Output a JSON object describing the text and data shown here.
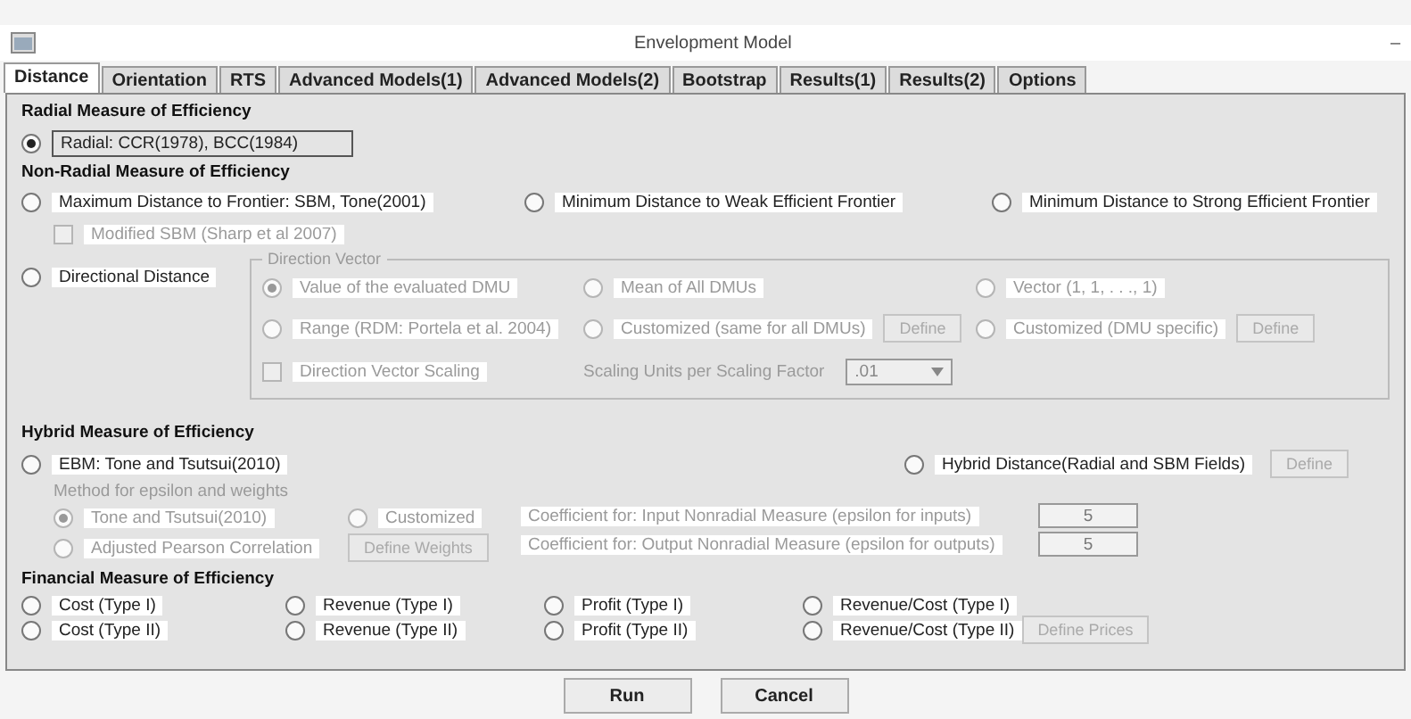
{
  "window": {
    "title": "Envelopment Model",
    "minimize": "–"
  },
  "tabs": [
    {
      "label": "Distance",
      "selected": true
    },
    {
      "label": "Orientation",
      "selected": false
    },
    {
      "label": "RTS",
      "selected": false
    },
    {
      "label": "Advanced Models(1)",
      "selected": false
    },
    {
      "label": "Advanced Models(2)",
      "selected": false
    },
    {
      "label": "Bootstrap",
      "selected": false
    },
    {
      "label": "Results(1)",
      "selected": false
    },
    {
      "label": "Results(2)",
      "selected": false
    },
    {
      "label": "Options",
      "selected": false
    }
  ],
  "radial": {
    "heading": "Radial Measure of Efficiency",
    "option": {
      "label": "Radial: CCR(1978), BCC(1984)",
      "selected": true
    }
  },
  "non_radial": {
    "heading": "Non-Radial Measure of Efficiency",
    "options": [
      {
        "label": "Maximum Distance to Frontier: SBM, Tone(2001)",
        "selected": false
      },
      {
        "label": "Minimum Distance to Weak Efficient Frontier",
        "selected": false
      },
      {
        "label": "Minimum Distance to Strong Efficient Frontier",
        "selected": false
      }
    ],
    "modified_sbm": {
      "label": "Modified SBM (Sharp et al 2007)",
      "checked": false,
      "disabled": true
    }
  },
  "directional": {
    "option": {
      "label": "Directional Distance",
      "selected": false
    },
    "group": {
      "title": "Direction Vector",
      "disabled": true,
      "options": [
        {
          "label": "Value of the evaluated DMU",
          "selected": true
        },
        {
          "label": "Mean of All DMUs",
          "selected": false
        },
        {
          "label": "Vector (1, 1, . . ., 1)",
          "selected": false
        },
        {
          "label": "Range (RDM: Portela et al. 2004)",
          "selected": false
        },
        {
          "label": "Customized (same for all DMUs)",
          "selected": false,
          "button": "Define"
        },
        {
          "label": "Customized (DMU specific)",
          "selected": false,
          "button": "Define"
        }
      ],
      "scaling": {
        "label": "Direction Vector Scaling",
        "checked": false
      },
      "scaling_units": {
        "label": "Scaling Units per Scaling Factor",
        "value": ".01"
      }
    }
  },
  "hybrid": {
    "heading": "Hybrid Measure of Efficiency",
    "options": [
      {
        "label": "EBM: Tone and Tsutsui(2010)",
        "selected": false
      },
      {
        "label": "Hybrid Distance(Radial and SBM Fields)",
        "selected": false,
        "button": "Define"
      }
    ],
    "method": {
      "title": "Method for epsilon and weights",
      "disabled": true,
      "options": [
        {
          "label": "Tone and Tsutsui(2010)",
          "selected": true
        },
        {
          "label": "Customized",
          "selected": false
        },
        {
          "label": "Adjusted Pearson Correlation",
          "selected": false
        }
      ],
      "button": "Define Weights"
    },
    "coefficients": [
      {
        "label": "Coefficient for: Input Nonradial Measure (epsilon for inputs)",
        "value": "5"
      },
      {
        "label": "Coefficient for: Output Nonradial Measure (epsilon for outputs)",
        "value": "5"
      }
    ]
  },
  "financial": {
    "heading": "Financial Measure of Efficiency",
    "options": [
      {
        "label": "Cost (Type I)",
        "selected": false
      },
      {
        "label": "Revenue (Type I)",
        "selected": false
      },
      {
        "label": "Profit (Type I)",
        "selected": false
      },
      {
        "label": "Revenue/Cost (Type I)",
        "selected": false
      },
      {
        "label": "Cost (Type II)",
        "selected": false
      },
      {
        "label": "Revenue (Type II)",
        "selected": false
      },
      {
        "label": "Profit (Type II)",
        "selected": false
      },
      {
        "label": "Revenue/Cost (Type II)",
        "selected": false
      }
    ],
    "button": "Define Prices"
  },
  "buttons": [
    {
      "label": "Run"
    },
    {
      "label": "Cancel"
    }
  ]
}
